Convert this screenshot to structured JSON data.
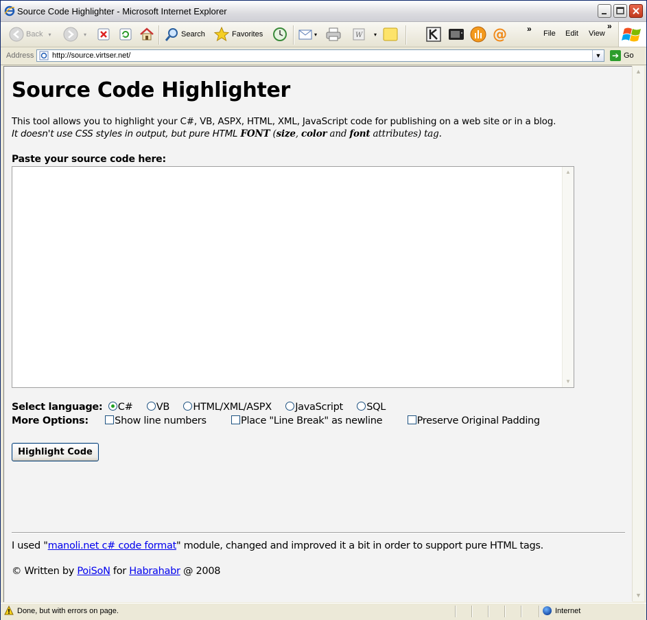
{
  "window": {
    "title": "Source Code Highlighter - Microsoft Internet Explorer"
  },
  "toolbar": {
    "back_label": "Back",
    "search_label": "Search",
    "favorites_label": "Favorites",
    "menus": [
      "File",
      "Edit",
      "View"
    ],
    "chevron": "»"
  },
  "address_bar": {
    "label": "Address",
    "url": "http://source.virtser.net/",
    "go_label": "Go"
  },
  "page": {
    "heading": "Source Code Highlighter",
    "intro_line1": "This tool allows you to highlight your C#, VB, ASPX, HTML, XML, JavaScript code for publishing on a web site or in a blog.",
    "intro_line2_a": "It doesn't use CSS styles in output, but pure HTML ",
    "intro_line2_font": "FONT",
    "intro_line2_b": " (",
    "intro_line2_size": "size",
    "intro_line2_c": ", ",
    "intro_line2_color": "color",
    "intro_line2_d": " and ",
    "intro_line2_fontattr": "font",
    "intro_line2_e": " attributes) tag.",
    "paste_label": "Paste your source code here:",
    "code_value": "",
    "select_language_label": "Select language:",
    "languages": [
      {
        "label": "C#",
        "selected": true
      },
      {
        "label": "VB",
        "selected": false
      },
      {
        "label": "HTML/XML/ASPX",
        "selected": false
      },
      {
        "label": "JavaScript",
        "selected": false
      },
      {
        "label": "SQL",
        "selected": false
      }
    ],
    "more_options_label": "More Options:",
    "options": [
      {
        "label": "Show line numbers",
        "checked": false
      },
      {
        "label": "Place \"Line Break\" as newline",
        "checked": false
      },
      {
        "label": "Preserve Original Padding",
        "checked": false
      }
    ],
    "highlight_button": "Highlight Code",
    "footer1_a": "I used \"",
    "footer1_link": "manoli.net c# code format",
    "footer1_b": "\" module, changed and improved it a bit in order to support pure HTML tags.",
    "footer2_a": "© Written by ",
    "footer2_author": "PoiSoN",
    "footer2_b": " for ",
    "footer2_site": "Habrahabr",
    "footer2_c": " @ 2008"
  },
  "status_bar": {
    "message": "Done, but with errors on page.",
    "zone": "Internet"
  }
}
